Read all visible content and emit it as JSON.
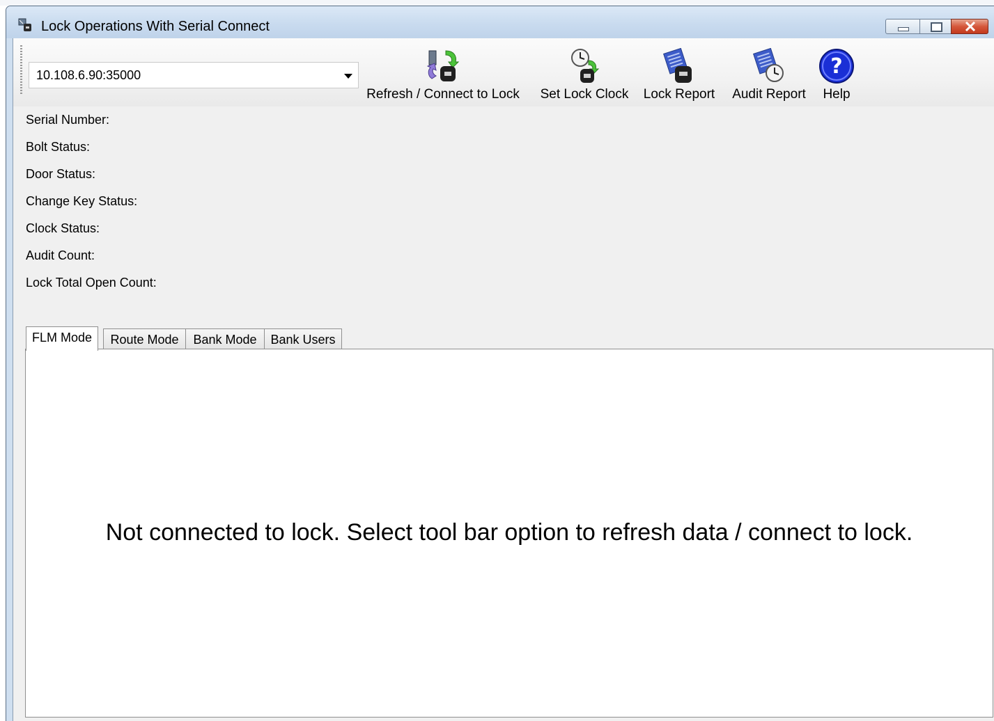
{
  "window": {
    "title": "Lock Operations With Serial Connect",
    "icon": "lock-serial-app-icon",
    "controls": [
      "minimize",
      "maximize",
      "close"
    ]
  },
  "toolbar": {
    "connection": {
      "value": "10.108.6.90:35000"
    },
    "buttons": [
      {
        "label": "Refresh / Connect to Lock",
        "icon": "refresh-connect-icon"
      },
      {
        "label": "Set Lock Clock",
        "icon": "set-clock-icon"
      },
      {
        "label": "Lock Report",
        "icon": "lock-report-icon"
      },
      {
        "label": "Audit Report",
        "icon": "audit-report-icon"
      },
      {
        "label": "Help",
        "icon": "help-icon"
      }
    ]
  },
  "status": {
    "serial_number": "Serial Number:",
    "bolt_status": "Bolt Status:",
    "door_status": "Door Status:",
    "change_key_status": "Change Key Status:",
    "clock_status": "Clock Status:",
    "audit_count": "Audit Count:",
    "lock_total_open_count": "Lock Total Open Count:"
  },
  "tabs": [
    "FLM Mode",
    "Route Mode",
    "Bank Mode",
    "Bank Users"
  ],
  "active_tab": "FLM Mode",
  "panel": {
    "message": "Not connected to lock.  Select tool bar option to refresh data / connect to lock."
  },
  "colors": {
    "help_blue": "#1a2fd6",
    "close_red": "#c8432a",
    "window_frame": "#cfdff0"
  }
}
